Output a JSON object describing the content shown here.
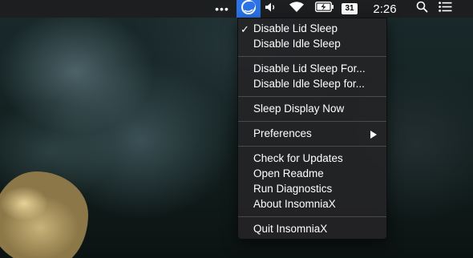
{
  "menubar": {
    "overflow_label": "•••",
    "app_icon": "insomniax-moon-icon",
    "volume_icon": "volume-icon",
    "wifi_icon": "wifi-icon",
    "battery_icon": "battery-charging-icon",
    "calendar_day": "31",
    "clock": "2:26",
    "search_icon": "spotlight-search-icon",
    "notification_icon": "notification-center-icon",
    "accent_color": "#2b73e6"
  },
  "menu": {
    "items": [
      {
        "label": "Disable Lid Sleep",
        "checked": "✓"
      },
      {
        "label": "Disable Idle Sleep"
      },
      {
        "label": "Disable Lid Sleep For..."
      },
      {
        "label": "Disable Idle Sleep for..."
      },
      {
        "label": "Sleep Display Now"
      },
      {
        "label": "Preferences",
        "submenu_icon": "submenu-arrow-icon"
      },
      {
        "label": "Check for Updates"
      },
      {
        "label": "Open Readme"
      },
      {
        "label": "Run Diagnostics"
      },
      {
        "label": "About InsomniaX"
      },
      {
        "label": "Quit InsomniaX"
      }
    ]
  }
}
